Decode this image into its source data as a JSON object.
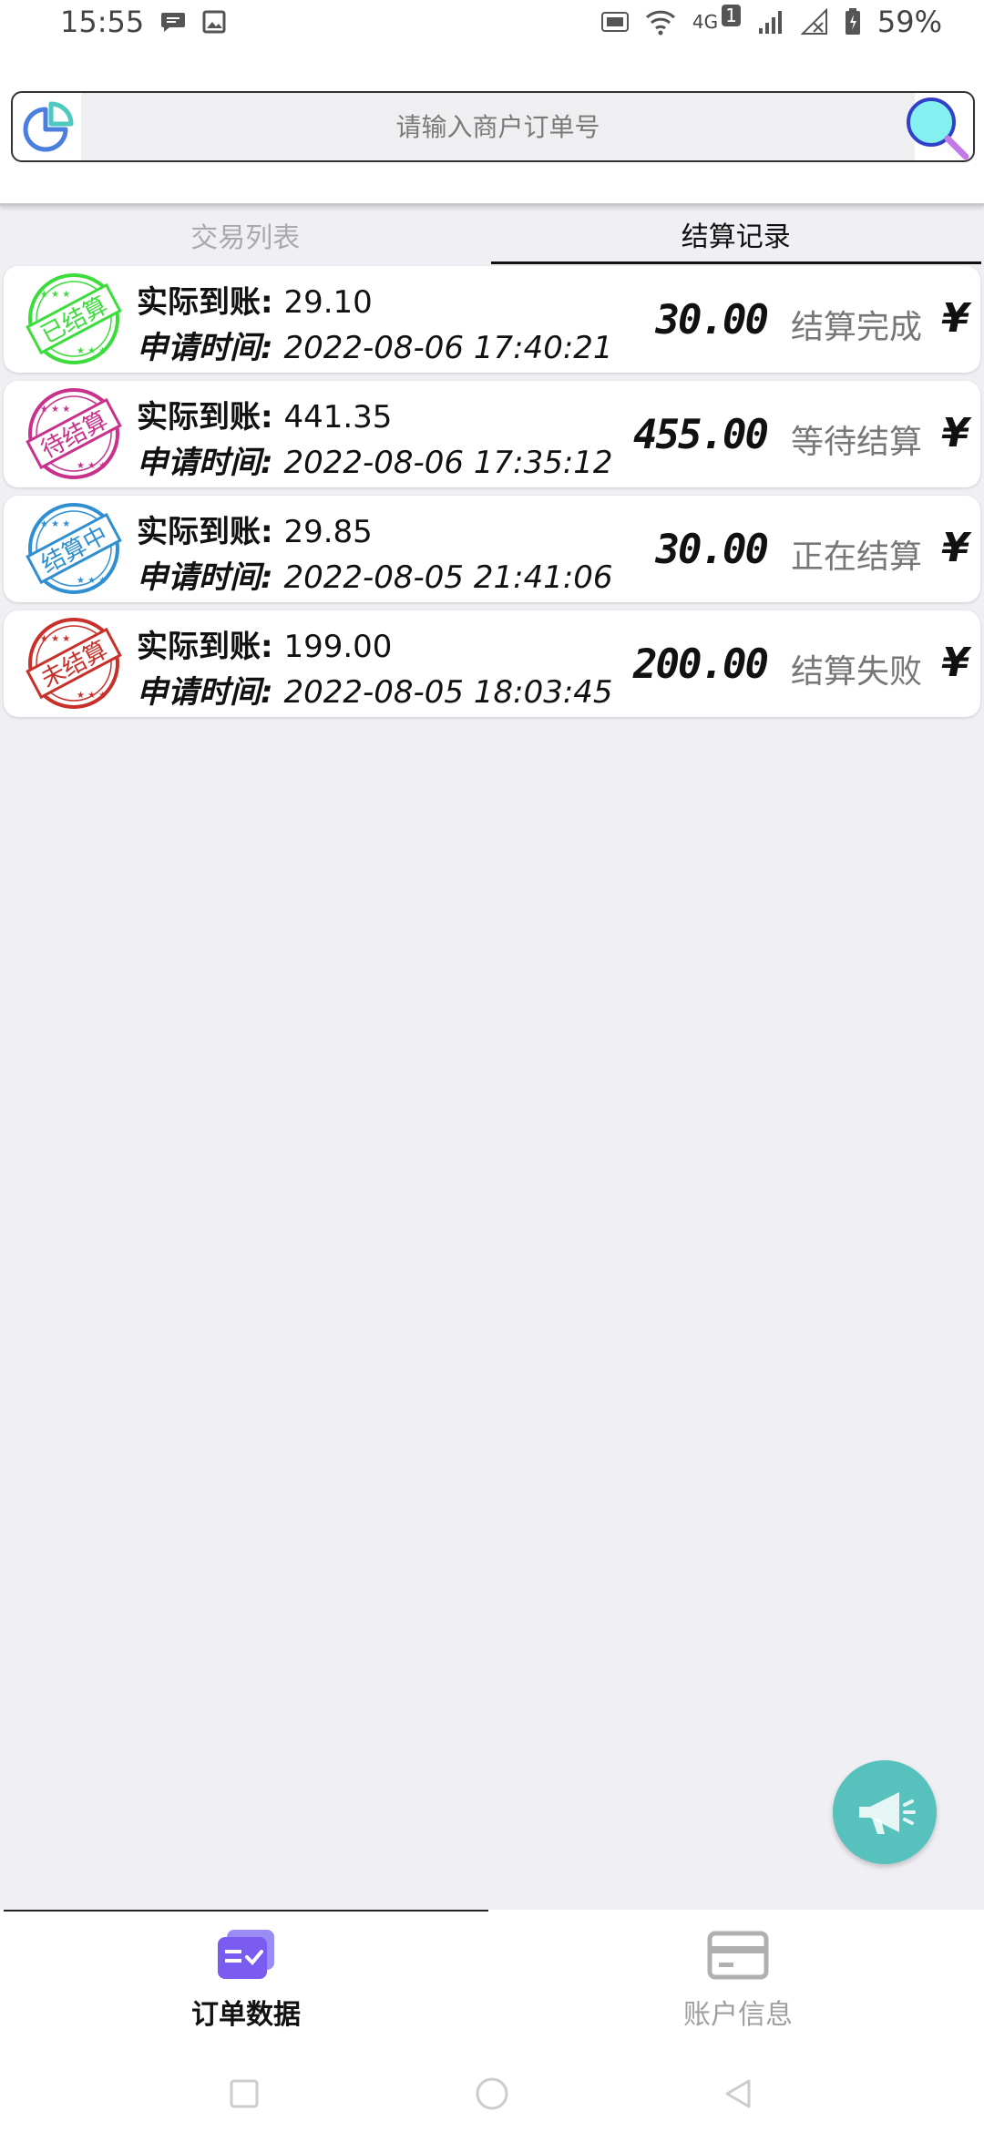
{
  "status_bar": {
    "time": "15:55",
    "network": "4G",
    "sim_badge": "1",
    "battery": "59%",
    "left_icons": [
      "message-icon",
      "image-icon"
    ],
    "right_icons": [
      "hd-icon",
      "wifi-icon",
      "signal-icon",
      "no-signal-icon",
      "battery-icon"
    ]
  },
  "search": {
    "placeholder": "请输入商户订单号",
    "left_icon": "pie-chart-icon",
    "right_icon": "search-icon"
  },
  "tabs": [
    {
      "label": "交易列表",
      "active": false
    },
    {
      "label": "结算记录",
      "active": true
    }
  ],
  "labels": {
    "actual": "实际到账:",
    "apply_time": "申请时间:"
  },
  "records": [
    {
      "stamp": "已结算",
      "stamp_color": "#3ddc3d",
      "actual": "29.10",
      "time": "2022-08-06 17:40:21",
      "amount": "30.00",
      "status": "结算完成",
      "currency": "¥"
    },
    {
      "stamp": "待结算",
      "stamp_color": "#c8328c",
      "actual": "441.35",
      "time": "2022-08-06 17:35:12",
      "amount": "455.00",
      "status": "等待结算",
      "currency": "¥"
    },
    {
      "stamp": "结算中",
      "stamp_color": "#2f8fd0",
      "actual": "29.85",
      "time": "2022-08-05 21:41:06",
      "amount": "30.00",
      "status": "正在结算",
      "currency": "¥"
    },
    {
      "stamp": "未结算",
      "stamp_color": "#c8302a",
      "actual": "199.00",
      "time": "2022-08-05 18:03:45",
      "amount": "200.00",
      "status": "结算失败",
      "currency": "¥"
    }
  ],
  "fab": {
    "icon": "megaphone-icon",
    "color": "#56c1bd"
  },
  "bottom_nav": [
    {
      "label": "订单数据",
      "icon": "order-data-icon",
      "active": true
    },
    {
      "label": "账户信息",
      "icon": "card-icon",
      "active": false
    }
  ],
  "colors": {
    "background": "#efeff4",
    "accent_purple": "#7a5cf0"
  }
}
